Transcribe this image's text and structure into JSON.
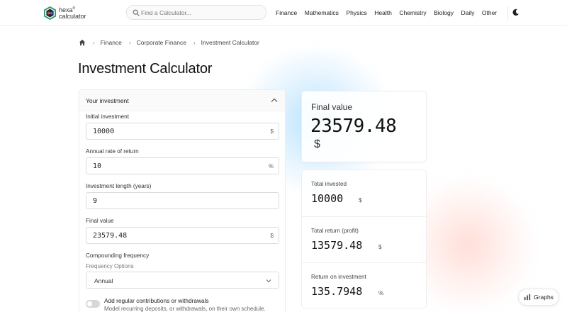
{
  "header": {
    "logo_line1": "hexa",
    "logo_reg": "®",
    "logo_line2": "calculator",
    "search_placeholder": "Find a Calculator...",
    "nav": [
      "Finance",
      "Mathematics",
      "Physics",
      "Health",
      "Chemistry",
      "Biology",
      "Daily",
      "Other"
    ]
  },
  "breadcrumb": [
    "Finance",
    "Corporate Finance",
    "Investment Calculator"
  ],
  "page_title": "Investment Calculator",
  "form": {
    "section_title": "Your investment",
    "initial_investment": {
      "label": "Initial investment",
      "value": "10000",
      "unit": "$"
    },
    "annual_rate": {
      "label": "Annual rate of return",
      "value": "10",
      "unit": "%"
    },
    "length": {
      "label": "Investment length (years)",
      "value": "9"
    },
    "final_value": {
      "label": "Final value",
      "value": "23579.48",
      "unit": "$"
    },
    "compounding": {
      "label": "Compounding frequency",
      "sub_label": "Frequency Options",
      "value": "Annual"
    },
    "contributions": {
      "label": "Add regular contributions or withdrawals",
      "sub_label": "Model recurring deposits, or withdrawals, on their own schedule.",
      "enabled": false
    }
  },
  "result": {
    "label": "Final value",
    "value": "23579.48",
    "unit": "$"
  },
  "stats": [
    {
      "label": "Total invested",
      "value": "10000",
      "unit": "$"
    },
    {
      "label": "Total return (profit)",
      "value": "13579.48",
      "unit": "$"
    },
    {
      "label": "Return on investment",
      "value": "135.7948",
      "unit": "%"
    }
  ],
  "graphs_button": "Graphs",
  "colors": {
    "accent_blue": "#96d4ff",
    "accent_red": "#ffc8be",
    "logo_green": "#2e9e6a",
    "logo_red": "#e0483c",
    "logo_blue": "#2f6fd6"
  }
}
